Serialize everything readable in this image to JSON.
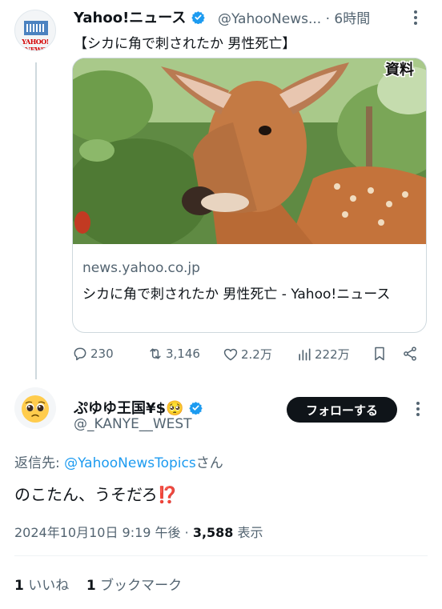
{
  "tweet1": {
    "author_name": "Yahoo!ニュース",
    "handle": "@YahooNews...",
    "time": "· 6時間",
    "text": "【シカに角で刺されたか 男性死亡】",
    "avatar_logo_text": "YAHOO! NEWS",
    "card": {
      "image_badge": "資料",
      "domain": "news.yahoo.co.jp",
      "title": "シカに角で刺されたか 男性死亡 - Yahoo!ニュース"
    },
    "actions": {
      "replies": "230",
      "reposts": "3,146",
      "likes": "2.2万",
      "views": "222万"
    }
  },
  "tweet2": {
    "author_name": "ぷゆゆ王国¥$🥺",
    "handle": "@_KANYE__WEST",
    "follow_label": "フォローする",
    "reply_to_prefix": "返信先: ",
    "reply_to_mention": "@YahooNewsTopics",
    "reply_to_suffix": "さん",
    "text": "のこたん、うそだろ",
    "text_emoji": "⁉️",
    "timestamp": "2024年10月10日 9:19 午後",
    "view_count": "3,588",
    "view_label": "表示",
    "likes_count": "1",
    "likes_label": "いいね",
    "bookmarks_count": "1",
    "bookmarks_label": "ブックマーク"
  },
  "colors": {
    "verified_blue": "#1d9bf0",
    "text_secondary": "#536471",
    "follow_bg": "#0f1419"
  }
}
